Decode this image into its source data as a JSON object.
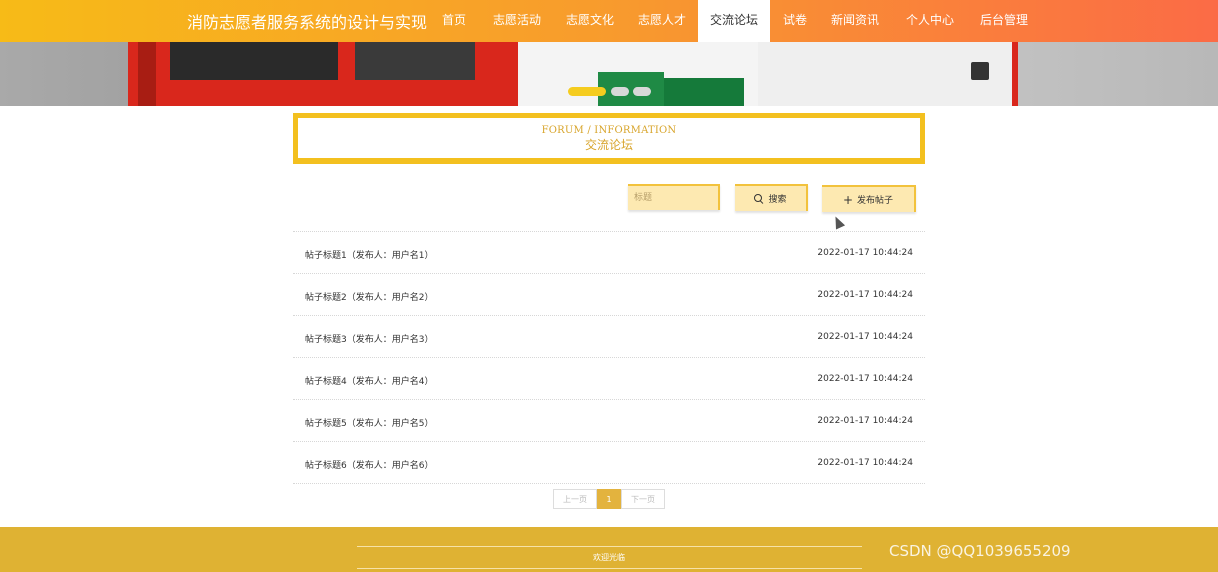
{
  "nav": {
    "site_title": "消防志愿者服务系统的设计与实现",
    "items": [
      {
        "label": "首页"
      },
      {
        "label": "志愿活动"
      },
      {
        "label": "志愿文化"
      },
      {
        "label": "志愿人才"
      },
      {
        "label": "交流论坛",
        "active": true
      },
      {
        "label": "试卷"
      },
      {
        "label": "新闻资讯"
      },
      {
        "label": "个人中心"
      },
      {
        "label": "后台管理"
      }
    ]
  },
  "banner": {
    "slides": 3,
    "active_slide": 1,
    "dot_color_active": "#f5cc1f"
  },
  "section": {
    "title_en": "FORUM / INFORMATION",
    "title_cn": "交流论坛"
  },
  "search": {
    "placeholder": "标题",
    "search_label": "搜索",
    "post_label": "发布帖子"
  },
  "posts": [
    {
      "title": "帖子标题1（发布人：用户名1）",
      "date": "2022-01-17 10:44:24"
    },
    {
      "title": "帖子标题2（发布人：用户名2）",
      "date": "2022-01-17 10:44:24"
    },
    {
      "title": "帖子标题3（发布人：用户名3）",
      "date": "2022-01-17 10:44:24"
    },
    {
      "title": "帖子标题4（发布人：用户名4）",
      "date": "2022-01-17 10:44:24"
    },
    {
      "title": "帖子标题5（发布人：用户名5）",
      "date": "2022-01-17 10:44:24"
    },
    {
      "title": "帖子标题6（发布人：用户名6）",
      "date": "2022-01-17 10:44:24"
    }
  ],
  "pagination": {
    "prev": "上一页",
    "current": "1",
    "next": "下一页"
  },
  "footer": {
    "text": "欢迎光临",
    "watermark": "CSDN @QQ1039655209"
  },
  "colors": {
    "accent": "#f3c01f",
    "footer": "#dfb233"
  },
  "icons": [
    "search-icon",
    "plus-icon"
  ]
}
